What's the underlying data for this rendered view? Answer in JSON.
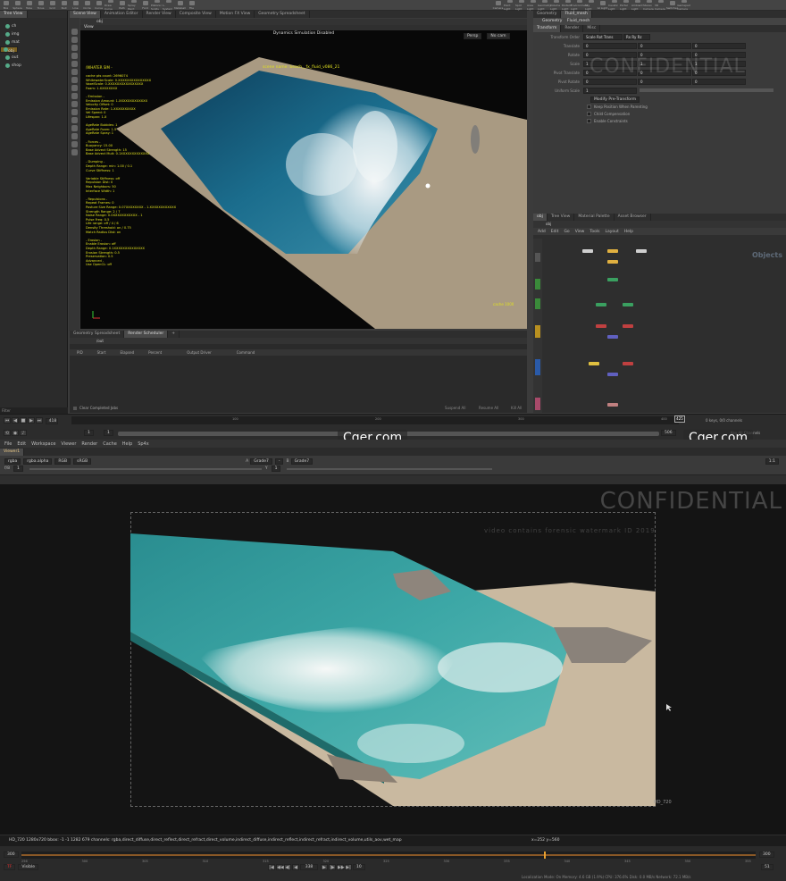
{
  "houdini": {
    "shelf_tools": [
      "Box",
      "Sphere",
      "Tube",
      "Torus",
      "Grid",
      "Null",
      "Line",
      "Circle",
      "Curve",
      "Draw Curve",
      "Path",
      "Spray Paint",
      "Font",
      "Platonic Solids",
      "L-System",
      "Metaball",
      "File"
    ],
    "light_tools": [
      "Camera",
      "Point Light",
      "Spot Light",
      "Area Light",
      "Geometry Light",
      "Volume Light",
      "Distant Light",
      "Environment Light",
      "Sky Light",
      "GI Light",
      "Caustic Light",
      "Portal Light",
      "Ambient Light",
      "Stereo Camera",
      "VR Camera",
      "Switcher",
      "Gamepad Camera"
    ],
    "left_tabs": [
      "Tree View",
      "Scene View"
    ],
    "tree_items": [
      "ch",
      "img",
      "mat",
      "obj",
      "out",
      "shop"
    ],
    "tree_selected_index": 3,
    "center_tabs": [
      "Scene View",
      "Animation Editor",
      "Render View",
      "Composite View",
      "Motion FX View",
      "Geometry Spreadsheet"
    ],
    "center_path": "obj",
    "viewport": {
      "title": "View",
      "sim_status": "Dynamics Simulation Disabled",
      "scene_name": "scene name: beach__fx_fluid_v086_21",
      "node_label": "/WHATER SIM -",
      "hud_lines": [
        "cache pts count: 2696074",
        "WhitewaterScale: 0.XXXXXXXXXXXXXXX",
        "VoxelScale: 0.XXXXXXXXXXXXXXXX",
        "Foam: 1.XXXXXXXX",
        "",
        "- Emission -",
        "Emission Amount: 1.XXXXXXXXXXXXX",
        "Velocity Offset: 0",
        "Emission Rate: 1.XXXXXXXXXX",
        "Vel Speed: 0",
        "Lifespan: 1.X",
        "",
        "AgeRate Bubbles: 1",
        "AgeRate Foam: 1.5",
        "AgeRate Spray: 1",
        "",
        "- Forces -",
        "Buoyancy: 15.00",
        "Base Advect Strength: 15",
        "Base Advect Mult: 0.1XXXXXXXXXXXXX",
        "",
        "- Dumping -",
        "Depth Range: min: 1.00 / 0.1",
        "Curve Stiffness: 1",
        "",
        "Variable Stiffness: off",
        "Repulsion Dist: 0",
        "Max Neighbors: 50",
        "Interface Width: 1",
        "",
        "- Repulsions -",
        "Repeat Frames: 0",
        "Posture Size Range: 0.07XXXXXXXX - 1.XXXXXXXXXXXX",
        "Strength Range: 2 / 7",
        "Noise Range: 0.0XXXXXXXXXXX - 1",
        "Pulse Freq: 0.5",
        "Life range: off / 4 / 6",
        "Density Threshold: on / 0.75",
        "Match Radius Dist: on",
        "",
        "- Erosion -",
        "Enable Erosion: off",
        "Depth Range: 0.1XXXXXXXXXXXXXX",
        "Erosion Strength: 0.5",
        "Preservation: 0.5",
        "Advanced -",
        "Use OpenCL: off"
      ],
      "bottom_label": "cache 1000",
      "persp_btn": "Persp",
      "cam_btn": "No cam"
    },
    "spreadsheet": {
      "tabs": [
        "Geometry Spreadsheet",
        "Render Scheduler"
      ],
      "path": "/out",
      "columns": [
        "PID",
        "Start",
        "Elapsed",
        "Percent",
        "Output Driver",
        "Command"
      ],
      "clear_label": "Clear Completed Jobs",
      "suspend_label": "Suspend All",
      "resume_label": "Resume All",
      "kill_label": "Kill All"
    },
    "params": {
      "tabs": [
        "Geometry",
        "Fluid_mesh"
      ],
      "node_type": "Geometry",
      "node_name": "Fluid_mesh",
      "sub_tabs": [
        "Transform",
        "Render",
        "Misc"
      ],
      "transform_order_label": "Transform Order",
      "transform_order_value": "Scale Rot Trans",
      "rot_order_value": "Rx Ry Rz",
      "rows": [
        {
          "label": "Translate",
          "values": [
            "0",
            "0",
            "0"
          ]
        },
        {
          "label": "Rotate",
          "values": [
            "0",
            "0",
            "0"
          ]
        },
        {
          "label": "Scale",
          "values": [
            "1",
            "1",
            "1"
          ]
        },
        {
          "label": "Pivot Translate",
          "values": [
            "0",
            "0",
            "0"
          ]
        },
        {
          "label": "Pivot Rotate",
          "values": [
            "0",
            "0",
            "0"
          ]
        },
        {
          "label": "Uniform Scale",
          "values": [
            "1"
          ]
        }
      ],
      "modify_pre": "Modify Pre-Transform",
      "checks": [
        "Keep Position When Parenting",
        "Child Compensation",
        "Enable Constraints"
      ]
    },
    "network": {
      "tabs": [
        "obj",
        "Tree View",
        "Material Palette",
        "Asset Browser"
      ],
      "menu": [
        "Add",
        "Edit",
        "Go",
        "View",
        "Tools",
        "Layout",
        "Help"
      ],
      "context_label": "Objects",
      "path": "obj"
    },
    "timeline": {
      "frame": "418",
      "start": "1",
      "end": "1",
      "range_start": "1",
      "range_end": "506",
      "current_end": "506",
      "ticks": [
        "100",
        "200",
        "300",
        "400"
      ],
      "keys_label": "0 keys, 0/0 channels",
      "key_all_label": "Key All Channels",
      "frame_badge": "425"
    }
  },
  "watermarks": {
    "left": "Cger.com",
    "right": "Cger.com",
    "confidential": [
      "CONFIDENTIAL",
      "CONFIDENTIAL"
    ],
    "forensic": "video contains forensic watermark ID 2019"
  },
  "nuke": {
    "menu": [
      "File",
      "Edit",
      "Workspace",
      "Viewer",
      "Render",
      "Cache",
      "Help",
      "Sp4x"
    ],
    "viewer_tab": "Viewer1",
    "channels": "rgba",
    "layer": "rgba.alpha",
    "display": "RGB",
    "colorspace": "sRGB",
    "a_input": "Grade7",
    "b_input": "Grade7",
    "wipe": "-",
    "frame_a": "1",
    "frame_b": "1",
    "gain": "1",
    "gamma": "1",
    "zoom": "1:1",
    "resolution_label": "HD_720",
    "status_text": "HD_720 1280x720  bbox: -1 -1 1282 679  channels: rgba,direct_diffuse,direct_reflect,direct_refract,direct_volume,indirect_diffuse,indirect_reflect,indirect_refract,indirect_volume,utils_aov,wet_map",
    "coords": "x=252 y=560",
    "timeline_ticks": [
      "256",
      "300",
      "305",
      "310",
      "315",
      "320",
      "325",
      "330",
      "335",
      "340",
      "345",
      "350",
      "355"
    ],
    "timeline_start": "300",
    "timeline_end": "300",
    "current_frame": "338",
    "fps": "TF",
    "visible": "Visible",
    "step": "10",
    "frame_field": "51",
    "footer": "Localization Mode: On  Memory: 4.6 GB (1.9%)  CPU: 376.6%  Disk: 0.0 MB/s  Network: 72.1 MB/s"
  }
}
